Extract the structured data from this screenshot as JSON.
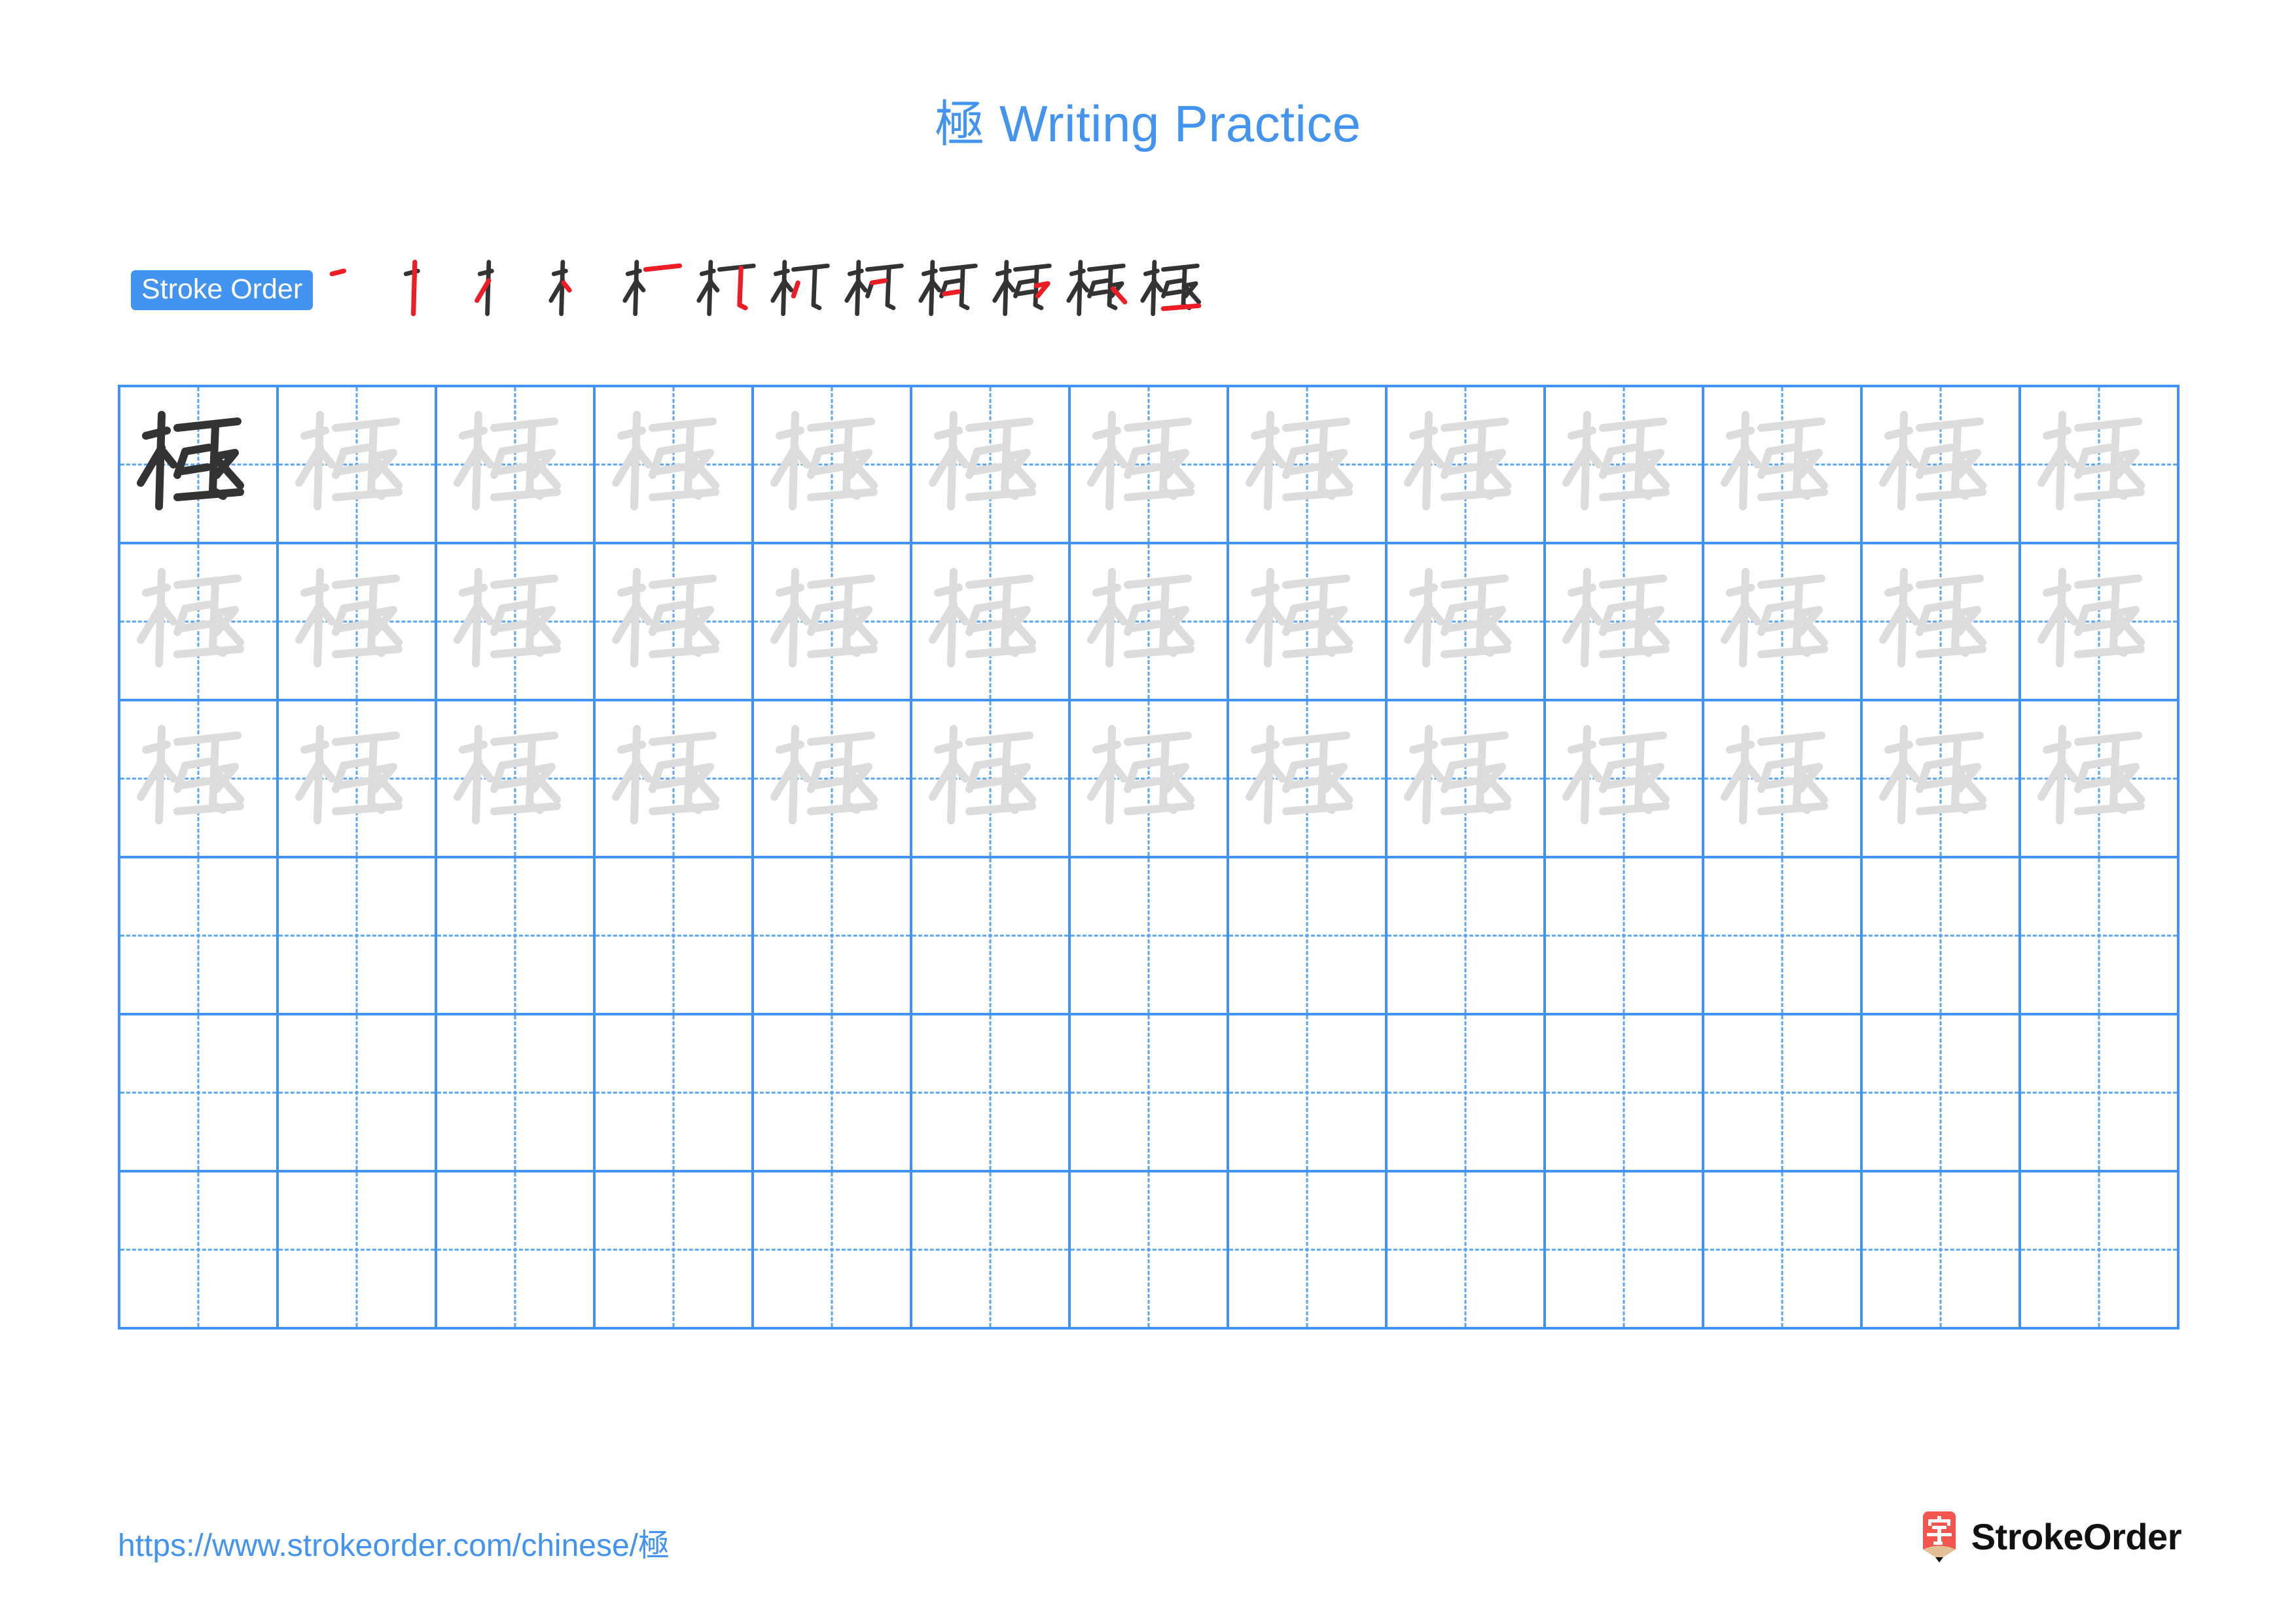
{
  "character": "極",
  "title": {
    "han": "極",
    "text": " Writing Practice"
  },
  "stroke_order": {
    "badge_label": "Stroke Order",
    "total_strokes": 12,
    "steps": [
      {
        "index": 1,
        "new_stroke": "㇐ heng (horizontal)",
        "accumulated": "一"
      },
      {
        "index": 2,
        "new_stroke": "㇑ shu (vertical)",
        "accumulated": "十"
      },
      {
        "index": 3,
        "new_stroke": "㇒ pie (left-falling)",
        "accumulated": "才"
      },
      {
        "index": 4,
        "new_stroke": "㇔ dian (right dot)",
        "accumulated": "木"
      },
      {
        "index": 5,
        "new_stroke": "㇐ heng (horizontal, right side)",
        "accumulated": "朾"
      },
      {
        "index": 6,
        "new_stroke": "㇆ hengzhe (horizontal-turn)",
        "accumulated": "杅"
      },
      {
        "index": 7,
        "new_stroke": "㇒ pie (left-falling)",
        "accumulated": "杒"
      },
      {
        "index": 8,
        "new_stroke": "㇏ na (right-falling)",
        "accumulated": "栐"
      },
      {
        "index": 9,
        "new_stroke": "㇐ heng (short horizontal)",
        "accumulated": "柯"
      },
      {
        "index": 10,
        "new_stroke": "㇇ hengpie (turn)",
        "accumulated": "栖"
      },
      {
        "index": 11,
        "new_stroke": "㇏ na (right-falling)",
        "accumulated": "極"
      },
      {
        "index": 12,
        "new_stroke": "㇐ heng (final base horizontal)",
        "accumulated": "極"
      }
    ]
  },
  "grid": {
    "columns": 13,
    "rows": 6,
    "model_cell": {
      "row": 1,
      "column": 1
    },
    "trace_rows": [
      1,
      2,
      3
    ],
    "blank_rows": [
      4,
      5,
      6
    ],
    "cells": [
      [
        "model",
        "trace",
        "trace",
        "trace",
        "trace",
        "trace",
        "trace",
        "trace",
        "trace",
        "trace",
        "trace",
        "trace",
        "trace"
      ],
      [
        "trace",
        "trace",
        "trace",
        "trace",
        "trace",
        "trace",
        "trace",
        "trace",
        "trace",
        "trace",
        "trace",
        "trace",
        "trace"
      ],
      [
        "trace",
        "trace",
        "trace",
        "trace",
        "trace",
        "trace",
        "trace",
        "trace",
        "trace",
        "trace",
        "trace",
        "trace",
        "trace"
      ],
      [
        "blank",
        "blank",
        "blank",
        "blank",
        "blank",
        "blank",
        "blank",
        "blank",
        "blank",
        "blank",
        "blank",
        "blank",
        "blank"
      ],
      [
        "blank",
        "blank",
        "blank",
        "blank",
        "blank",
        "blank",
        "blank",
        "blank",
        "blank",
        "blank",
        "blank",
        "blank",
        "blank"
      ],
      [
        "blank",
        "blank",
        "blank",
        "blank",
        "blank",
        "blank",
        "blank",
        "blank",
        "blank",
        "blank",
        "blank",
        "blank",
        "blank"
      ]
    ]
  },
  "footer": {
    "url_prefix": "https://www.strokeorder.com/chinese/",
    "url_han": "極",
    "brand_name": "StrokeOrder",
    "brand_mark_char": "字"
  },
  "colors": {
    "accent_blue": "#4294f0",
    "grid_line": "#4294f0",
    "grid_dash": "#5aa5f5",
    "model_ink": "#333333",
    "trace_ink": "#dcdcdc",
    "stroke_new": "#ee1c25",
    "stroke_done": "#333333",
    "logo_red": "#f2564f",
    "logo_wood": "#e2bf95",
    "logo_lead": "#111111"
  }
}
